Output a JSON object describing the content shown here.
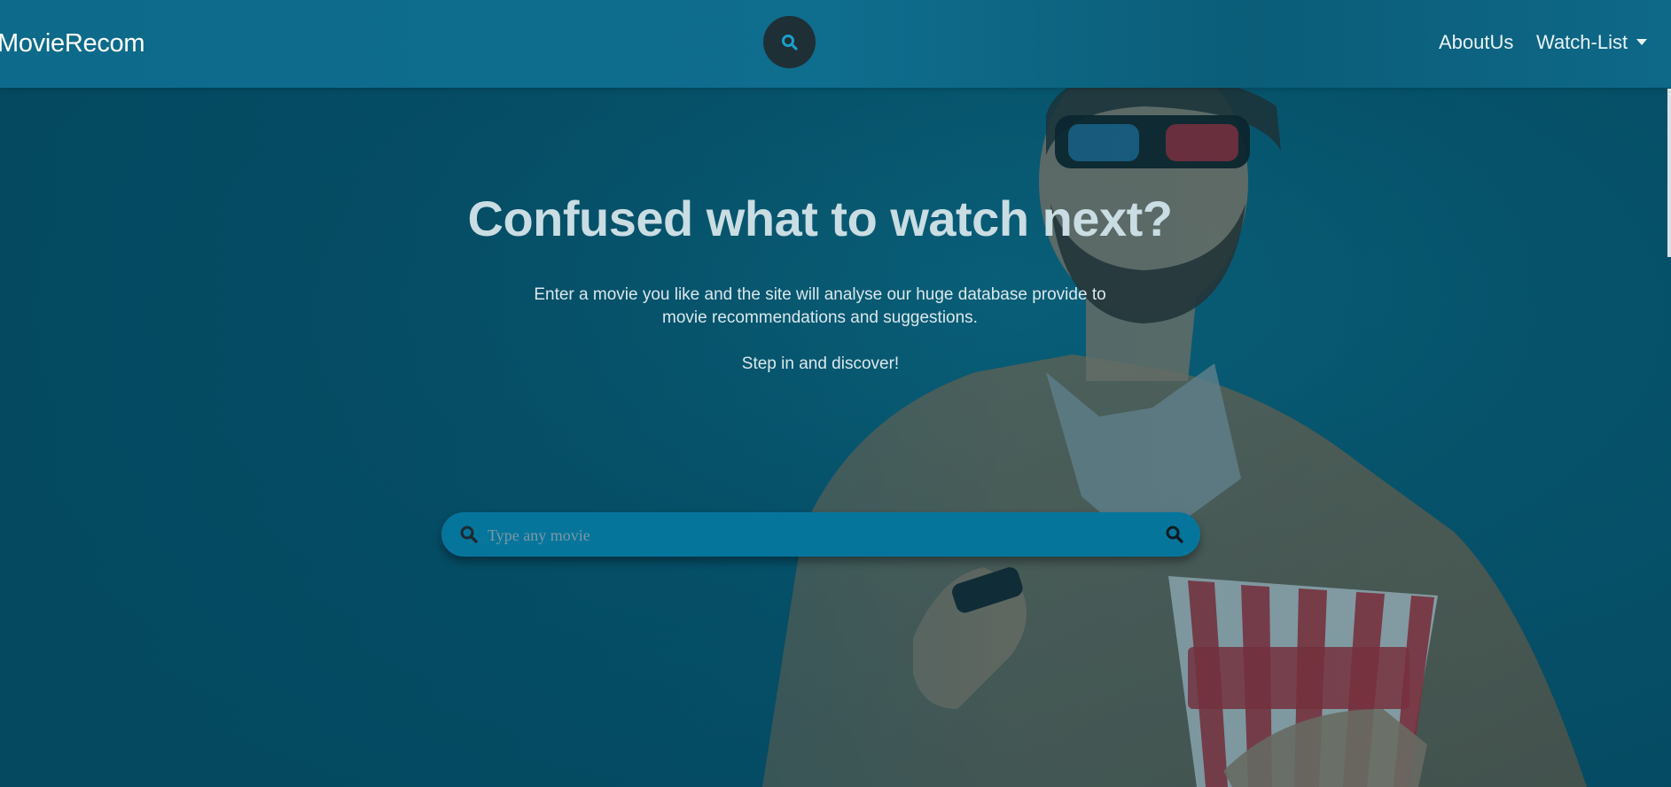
{
  "navbar": {
    "brand": "MovieRecom",
    "search_icon": "search-icon",
    "links": [
      {
        "label": "AboutUs"
      },
      {
        "label": "Watch-List",
        "has_dropdown": true
      }
    ]
  },
  "hero": {
    "headline": "Confused what to watch next?",
    "description": "Enter a movie you like and the site will analyse our huge database provide to movie recommendations and suggestions.",
    "cta": "Step in and discover!",
    "image": "man-with-3d-glasses-holding-remote-and-popcorn"
  },
  "search": {
    "placeholder": "Type any movie",
    "value": "",
    "left_icon": "search-icon",
    "right_icon": "search-icon"
  },
  "colors": {
    "background": "#075f7a",
    "navbar": "#0f6d8d",
    "search_bar": "#06759c",
    "nav_search_button": "#1f2f36",
    "headline": "#c9dde3"
  }
}
